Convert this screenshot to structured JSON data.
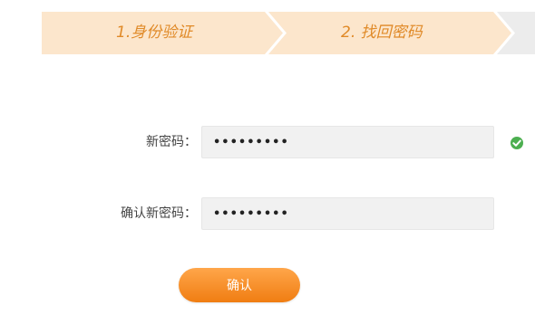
{
  "steps": [
    {
      "label": "1.身份验证"
    },
    {
      "label": "2. 找回密码"
    }
  ],
  "form": {
    "new_password_label": "新密码：",
    "new_password_value": "•••••••••",
    "confirm_password_label": "确认新密码：",
    "confirm_password_value": "•••••••••",
    "valid_icon": "check-circle-icon"
  },
  "actions": {
    "confirm_label": "确认"
  },
  "colors": {
    "step_active_bg": "#fce6cc",
    "step_text": "#e08a28",
    "button": "#f58a1f",
    "valid": "#4caf50"
  }
}
